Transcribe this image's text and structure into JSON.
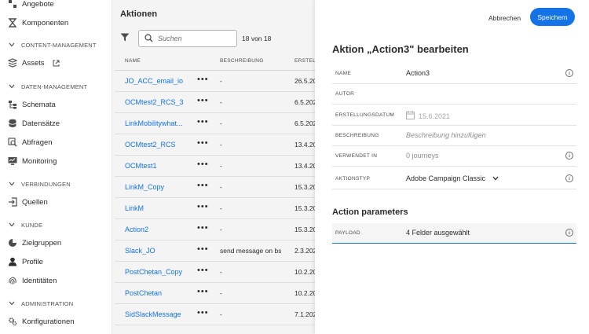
{
  "sidebar": {
    "items_top": [
      {
        "label": "Angebote",
        "icon": "offers-icon"
      },
      {
        "label": "Komponenten",
        "icon": "components-icon"
      }
    ],
    "sections": [
      {
        "label": "CONTENT-MANAGEMENT"
      },
      {
        "label": "DATEN-MANAGEMENT"
      },
      {
        "label": "VERBINDUNGEN"
      },
      {
        "label": "KUNDE"
      },
      {
        "label": "ADMINISTRATION"
      }
    ],
    "assets": "Assets",
    "schemata": "Schemata",
    "datensaetze": "Datensätze",
    "abfragen": "Abfragen",
    "monitoring": "Monitoring",
    "quellen": "Quellen",
    "zielgruppen": "Zielgruppen",
    "profile": "Profile",
    "identitaeten": "Identitäten",
    "konfigurationen": "Konfigurationen"
  },
  "list": {
    "title": "Aktionen",
    "search_placeholder": "Suchen",
    "count": "18 von 18",
    "columns": {
      "name": "NAME",
      "description": "BESCHREIBUNG",
      "created": "ERSTELL"
    },
    "rows": [
      {
        "name": "JO_ACC_email_io",
        "more": "•••",
        "desc": "-",
        "date": "26.5.20"
      },
      {
        "name": "OCMtest2_RCS_3",
        "more": "•••",
        "desc": "-",
        "date": "6.5.202"
      },
      {
        "name": "LinkMobilitywhat...",
        "more": "•••",
        "desc": "-",
        "date": "6.5.202"
      },
      {
        "name": "OCMtest2_RCS",
        "more": "•••",
        "desc": "-",
        "date": "13.4.20"
      },
      {
        "name": "OCMtest1",
        "more": "•••",
        "desc": "-",
        "date": "13.4.20"
      },
      {
        "name": "LinkM_Copy",
        "more": "•••",
        "desc": "-",
        "date": "15.3.20"
      },
      {
        "name": "LinkM",
        "more": "•••",
        "desc": "-",
        "date": "15.3.20"
      },
      {
        "name": "Action2",
        "more": "•••",
        "desc": "-",
        "date": "15.3.20"
      },
      {
        "name": "Slack_JO",
        "more": "•••",
        "desc": "send message on bs",
        "date": "2.3.202"
      },
      {
        "name": "PostChetan_Copy",
        "more": "•••",
        "desc": "-",
        "date": "10.2.20"
      },
      {
        "name": "PostChetan",
        "more": "•••",
        "desc": "-",
        "date": "10.2.20"
      },
      {
        "name": "SidSlackMessage",
        "more": "•••",
        "desc": "-",
        "date": "7.1.202"
      }
    ]
  },
  "panel": {
    "cancel_label": "Abbrechen",
    "save_label": "Speichern",
    "title": "Aktion „Action3\" bearbeiten",
    "fields": {
      "name": {
        "label": "NAME",
        "value": "Action3"
      },
      "author": {
        "label": "AUTOR",
        "value": ""
      },
      "created": {
        "label": "ERSTELLUNGSDATUM",
        "value": "15.6.2021"
      },
      "description": {
        "label": "BESCHREIBUNG",
        "value": "Beschreibung hinzufügen"
      },
      "used_in": {
        "label": "VERWENDET IN",
        "value": "0 journeys"
      },
      "type": {
        "label": "AKTIONSTYP",
        "value": "Adobe Campaign Classic"
      }
    },
    "section_title": "Action parameters",
    "payload": {
      "label": "PAYLOAD",
      "value": "4 Felder ausgewählt"
    }
  },
  "colors": {
    "accent": "#1473e6",
    "list_bg": "#f4f4f4"
  }
}
